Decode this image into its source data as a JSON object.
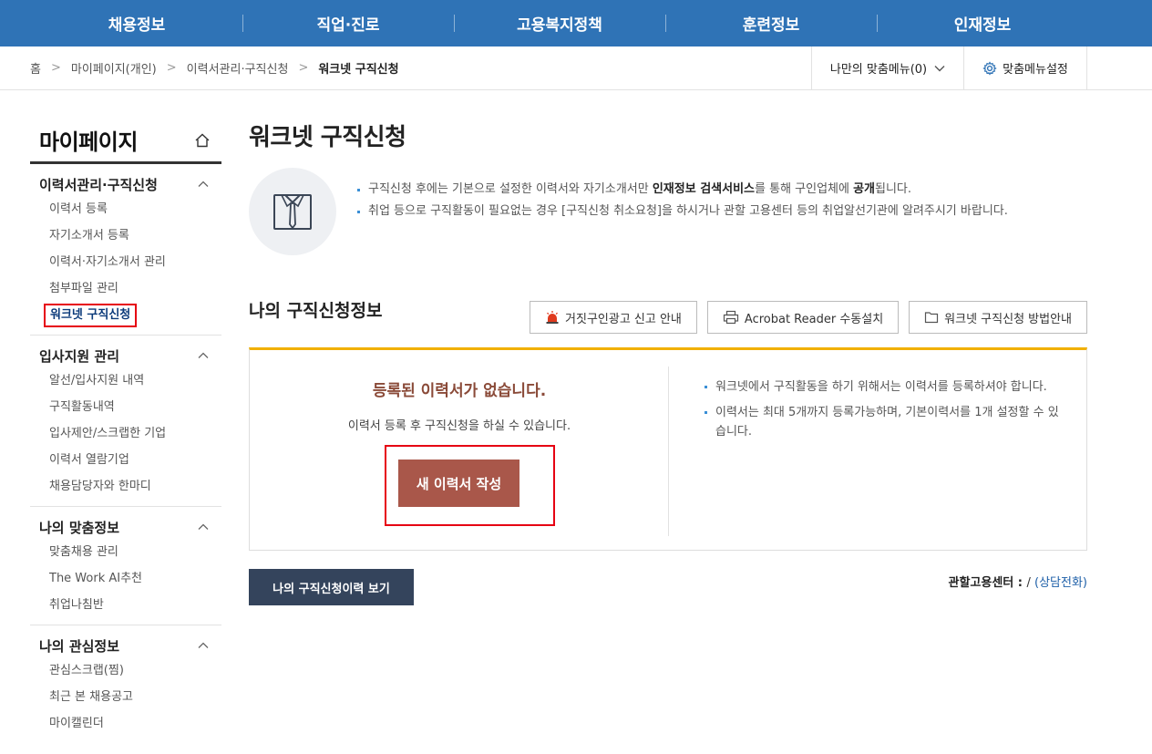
{
  "topnav": [
    "채용정보",
    "직업·진로",
    "고용복지정책",
    "훈련정보",
    "인재정보"
  ],
  "breadcrumb": {
    "home": "홈",
    "items": [
      "마이페이지(개인)",
      "이력서관리·구직신청"
    ],
    "current": "워크넷 구직신청"
  },
  "mymenu": {
    "label": "나만의 맞춤메뉴(0)"
  },
  "menuset": {
    "label": "맞춤메뉴설정"
  },
  "sidebar": {
    "title": "마이페이지",
    "groups": [
      {
        "title": "이력서관리·구직신청",
        "items": [
          "이력서 등록",
          "자기소개서 등록",
          "이력서·자기소개서 관리",
          "첨부파일 관리",
          "워크넷 구직신청"
        ]
      },
      {
        "title": "입사지원 관리",
        "items": [
          "알선/입사지원 내역",
          "구직활동내역",
          "입사제안/스크랩한 기업",
          "이력서 열람기업",
          "채용담당자와 한마디"
        ]
      },
      {
        "title": "나의 맞춤정보",
        "items": [
          "맞춤채용 관리",
          "The Work AI추천",
          "취업나침반"
        ]
      },
      {
        "title": "나의 관심정보",
        "items": [
          "관심스크랩(찜)",
          "최근 본 채용공고",
          "마이캘린더"
        ]
      }
    ]
  },
  "main": {
    "title": "워크넷 구직신청",
    "info": {
      "line1_a": "구직신청 후에는 기본으로 설정한 이력서와 자기소개서만 ",
      "line1_b": "인재정보 검색서비스",
      "line1_c": "를 통해 구인업체에 ",
      "line1_d": "공개",
      "line1_e": "됩니다.",
      "line2": "취업 등으로 구직활동이 필요없는 경우 [구직신청 취소요청]을 하시거나 관할 고용센터 등의 취업알선기관에 알려주시기 바랍니다."
    },
    "section_title": "나의 구직신청정보",
    "buttons": [
      "거짓구인광고 신고 안내",
      "Acrobat Reader 수동설치",
      "워크넷 구직신청 방법안내"
    ],
    "box": {
      "empty_title": "등록된 이력서가 없습니다.",
      "empty_sub": "이력서 등록 후 구직신청을 하실 수 있습니다.",
      "new_button": "새 이력서 작성",
      "notes": [
        "워크넷에서 구직활동을 하기 위해서는 이력서를 등록하셔야 합니다.",
        "이력서는 최대 5개까지 등록가능하며, 기본이력서를 1개 설정할 수 있습니다."
      ]
    },
    "history_button": "나의 구직신청이력 보기",
    "center": {
      "label": "관할고용센터 : ",
      "value": "/ ",
      "link": "(상담전화)"
    }
  }
}
